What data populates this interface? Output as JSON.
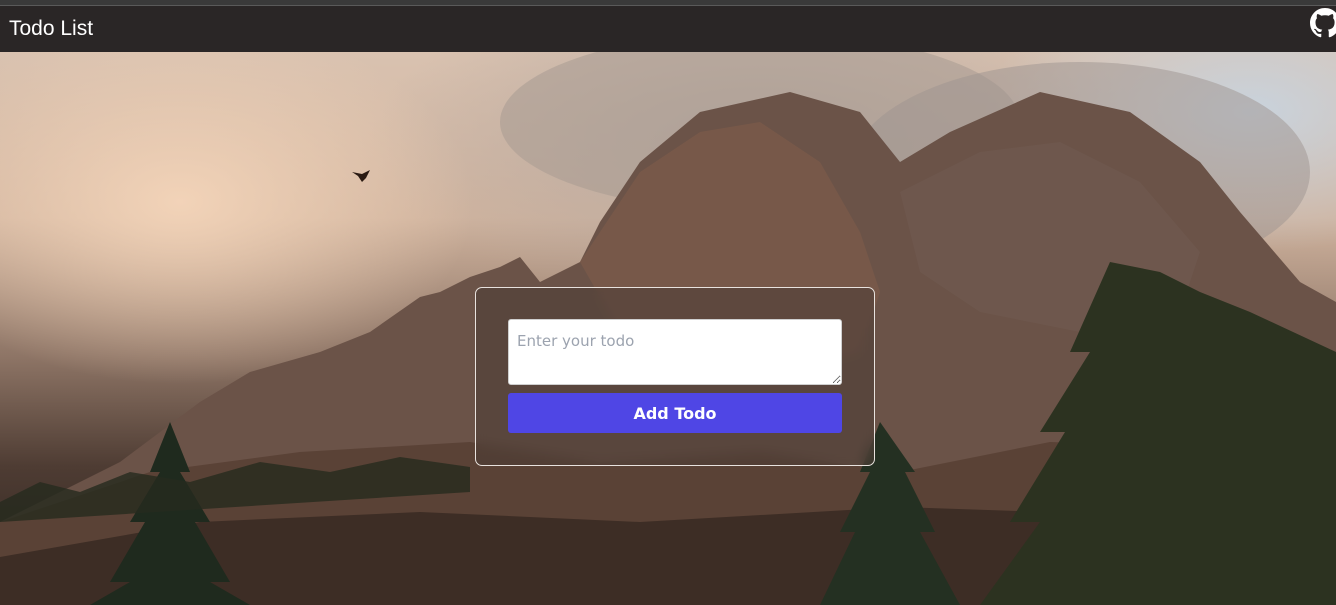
{
  "navbar": {
    "title": "Todo List",
    "github_icon": "github-icon"
  },
  "form": {
    "input_placeholder": "Enter your todo",
    "input_value": "",
    "button_label": "Add Todo"
  },
  "colors": {
    "navbar_bg": "#2a2626",
    "button_bg": "#4f46e5",
    "button_text": "#ffffff"
  },
  "background": {
    "description_icon": "mountain-landscape-image"
  }
}
